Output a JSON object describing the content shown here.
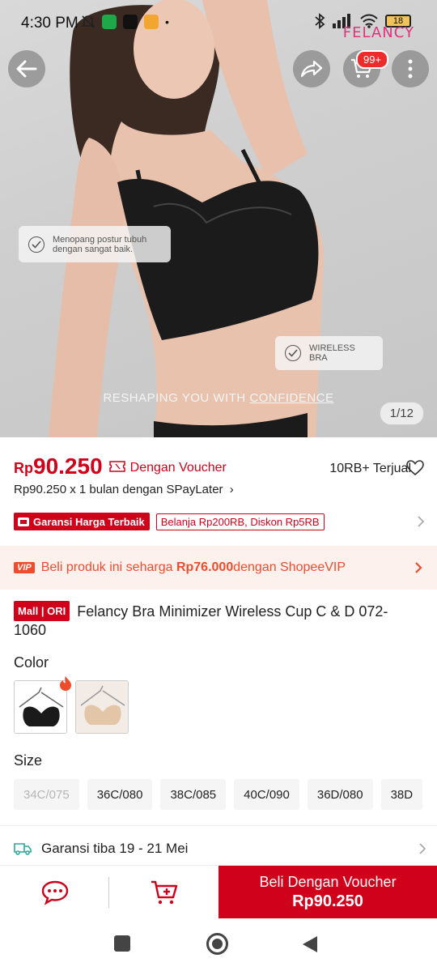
{
  "status_bar": {
    "time": "4:30 PM",
    "carrier": "FELANCY",
    "battery": "18"
  },
  "hero": {
    "card1_text": "Menopang postur tubuh dengan sangat baik.",
    "card2_text": "WIRELESS BRA",
    "slogan_a": "RESHAPING YOU WITH ",
    "slogan_b": "CONFIDENCE",
    "counter": "1/12",
    "cart_badge": "99+"
  },
  "price": {
    "currency": "Rp",
    "amount": "90.250",
    "voucher_label": "Dengan Voucher",
    "sold": "10RB+ Terjual",
    "paylater": "Rp90.250 x 1 bulan dengan SPayLater"
  },
  "badges": {
    "guarantee": "Garansi Harga Terbaik",
    "promo": "Belanja Rp200RB, Diskon Rp5RB"
  },
  "vip": {
    "tag": "VIP",
    "text_a": "Beli produk ini seharga ",
    "price": "Rp76.000",
    "text_b": " dengan ShopeeVIP"
  },
  "product": {
    "mall_tag": "Mall | ORI",
    "title": "Felancy Bra Minimizer Wireless Cup C & D 072-1060"
  },
  "options": {
    "color_label": "Color",
    "size_label": "Size",
    "sizes": [
      "34C/075",
      "36C/080",
      "38C/085",
      "40C/090",
      "36D/080",
      "38D"
    ]
  },
  "delivery": {
    "text": "Garansi tiba 19 - 21 Mei"
  },
  "bottom": {
    "buy_line1": "Beli Dengan Voucher",
    "buy_line2": "Rp90.250"
  },
  "colors": {
    "primary_red": "#d0011b",
    "shopee_orange": "#ee4d2d",
    "delivery_teal": "#26aa99"
  }
}
